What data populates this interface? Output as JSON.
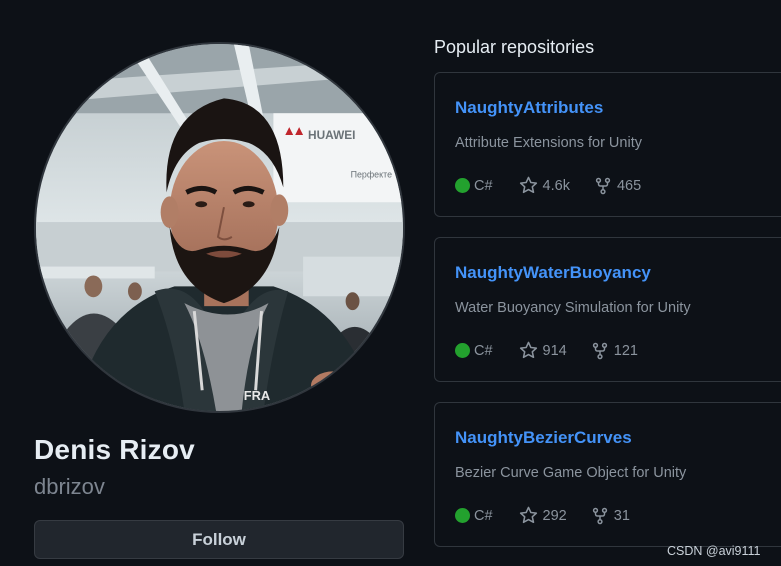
{
  "profile": {
    "name": "Denis Rizov",
    "login": "dbrizov",
    "follow_label": "Follow",
    "avatar_photo_text": [
      "HUAWEI",
      "HU",
      "Перфекте"
    ]
  },
  "popular": {
    "title": "Popular repositories",
    "repos": [
      {
        "name": "NaughtyAttributes",
        "description": "Attribute Extensions for Unity",
        "language": "C#",
        "language_color": "#23a12e",
        "stars": "4.6k",
        "forks": "465"
      },
      {
        "name": "NaughtyWaterBuoyancy",
        "description": "Water Buoyancy Simulation for Unity",
        "language": "C#",
        "language_color": "#23a12e",
        "stars": "914",
        "forks": "121"
      },
      {
        "name": "NaughtyBezierCurves",
        "description": "Bezier Curve Game Object for Unity",
        "language": "C#",
        "language_color": "#23a12e",
        "stars": "292",
        "forks": "31"
      }
    ]
  },
  "watermark": "CSDN @avi9111",
  "colors": {
    "background": "#0d1117",
    "link": "#4493f8",
    "border": "#30363d",
    "muted_text": "#8b949e"
  }
}
